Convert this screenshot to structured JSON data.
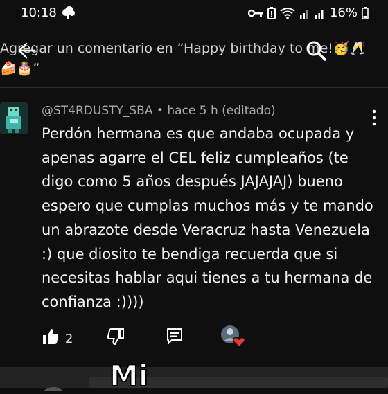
{
  "status_bar": {
    "time": "10:18",
    "battery": "16%"
  },
  "header": {
    "title": "Agregar un comentario en “Happy birthday to me!🥳🥂🍰🎂”"
  },
  "comment": {
    "author": "@ST4RDUSTY_SBA",
    "meta_suffix": " • hace 5 h (editado)",
    "text": "Perdón hermana es que andaba ocupada y apenas agarre el CEL feliz cumpleaños (te digo como 5 años después JAJAJAJ) bueno espero que cumplas muchos más y te mando un abrazote desde Veracruz hasta Venezuela :) que diosito te bendiga recuerda que si necesitas hablar aqui tienes a tu hermana de confianza :))))",
    "like_count": "2"
  },
  "overlay": {
    "caption": "Mi"
  },
  "colors": {
    "background": "#0f0f0f",
    "text": "#f1f1f1",
    "meta": "#aaaaaa",
    "heart": "#e53935"
  }
}
